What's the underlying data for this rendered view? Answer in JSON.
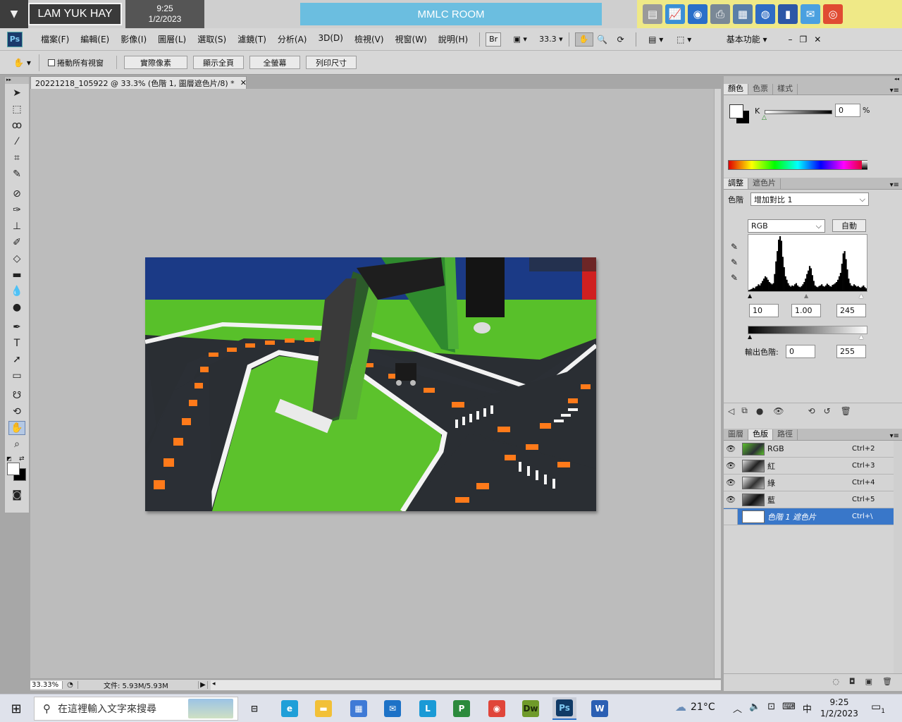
{
  "kiosk": {
    "user_name": "LAM YUK HAY",
    "time": "9:25",
    "date": "1/2/2023",
    "room": "MMLC ROOM",
    "tray_icons": [
      {
        "name": "document-icon",
        "color": "#9a9a9a",
        "glyph": "▤"
      },
      {
        "name": "chart-icon",
        "color": "#3a8fd6",
        "glyph": "📈"
      },
      {
        "name": "disc-icon",
        "color": "#2a6fc9",
        "glyph": "◉"
      },
      {
        "name": "printer-icon",
        "color": "#7a8896",
        "glyph": "⎙"
      },
      {
        "name": "window-icon",
        "color": "#5a7fa8",
        "glyph": "▦"
      },
      {
        "name": "globe-icon",
        "color": "#2f6cc4",
        "glyph": "◍"
      },
      {
        "name": "book-icon",
        "color": "#2d57a6",
        "glyph": "▮"
      },
      {
        "name": "chat-icon",
        "color": "#4aa0e0",
        "glyph": "✉"
      },
      {
        "name": "lifebuoy-icon",
        "color": "#e04b32",
        "glyph": "◎"
      }
    ]
  },
  "menubar": {
    "items": [
      "檔案(F)",
      "編輯(E)",
      "影像(I)",
      "圖層(L)",
      "選取(S)",
      "濾鏡(T)",
      "分析(A)",
      "3D(D)",
      "檢視(V)",
      "視窗(W)",
      "說明(H)"
    ],
    "bridge_label": "Br",
    "zoom_value": "33.3",
    "workspace": "基本功能"
  },
  "options": {
    "scroll_all_label": "捲動所有視窗",
    "buttons": [
      "實際像素",
      "顯示全頁",
      "全螢幕",
      "列印尺寸"
    ]
  },
  "document": {
    "tab_title": "20221218_105922 @ 33.3% (色階 1, 圖層遮色片/8) *",
    "zoom": "33.33%",
    "file_info": "文件: 5.93M/5.93M"
  },
  "color_panel": {
    "tabs": [
      "顏色",
      "色票",
      "樣式"
    ],
    "channel_label": "K",
    "value": "0",
    "unit": "%"
  },
  "adjust_panel": {
    "tabs": [
      "調整",
      "遮色片"
    ],
    "preset_label": "色階",
    "preset_value": "增加對比 1",
    "channel": "RGB",
    "auto_label": "自動",
    "input_black": "10",
    "input_gamma": "1.00",
    "input_white": "245",
    "output_label": "輸出色階:",
    "output_black": "0",
    "output_white": "255",
    "histogram": [
      2,
      3,
      4,
      6,
      5,
      8,
      9,
      12,
      10,
      14,
      18,
      22,
      26,
      24,
      20,
      16,
      14,
      12,
      14,
      30,
      52,
      70,
      90,
      96,
      88,
      60,
      42,
      26,
      20,
      14,
      10,
      8,
      10,
      9,
      12,
      14,
      10,
      8,
      7,
      9,
      12,
      16,
      22,
      30,
      36,
      44,
      40,
      28,
      18,
      10,
      8,
      7,
      9,
      10,
      12,
      9,
      8,
      10,
      13,
      11,
      9,
      8,
      11,
      12,
      14,
      16,
      20,
      26,
      32,
      48,
      66,
      70,
      56,
      38,
      22,
      14,
      10,
      9,
      12,
      10,
      8,
      9,
      7,
      6,
      8,
      10,
      7,
      5
    ]
  },
  "layers_panel": {
    "tabs": [
      "圖層",
      "色版",
      "路徑"
    ],
    "channels": [
      {
        "name": "RGB",
        "shortcut": "Ctrl+2"
      },
      {
        "name": "紅",
        "shortcut": "Ctrl+3"
      },
      {
        "name": "綠",
        "shortcut": "Ctrl+4"
      },
      {
        "name": "藍",
        "shortcut": "Ctrl+5"
      },
      {
        "name": "色階 1 遮色片",
        "shortcut": "Ctrl+\\"
      }
    ]
  },
  "taskbar": {
    "search_placeholder": "在這裡輸入文字來搜尋",
    "temperature": "21°C",
    "ime": "中",
    "time": "9:25",
    "date": "1/2/2023",
    "notification_count": "1",
    "apps": [
      {
        "name": "task-view-icon",
        "label": "⊟",
        "color": "#dfe2eb",
        "fg": "#222"
      },
      {
        "name": "edge-icon",
        "label": "e",
        "color": "#1f9fd8",
        "fg": "#fff"
      },
      {
        "name": "file-explorer-icon",
        "label": "▬",
        "color": "#f2c037",
        "fg": "#fff"
      },
      {
        "name": "store-icon",
        "label": "▦",
        "color": "#3f7ad6",
        "fg": "#fff"
      },
      {
        "name": "mail-icon",
        "label": "✉",
        "color": "#1d72c7",
        "fg": "#fff"
      },
      {
        "name": "l-app-icon",
        "label": "L",
        "color": "#1a9ad6",
        "fg": "#fff"
      },
      {
        "name": "p-app-icon",
        "label": "P",
        "color": "#2c8a3c",
        "fg": "#fff"
      },
      {
        "name": "chrome-icon",
        "label": "◉",
        "color": "#e0453a",
        "fg": "#fff"
      },
      {
        "name": "dreamweaver-icon",
        "label": "Dw",
        "color": "#6f9a2a",
        "fg": "#1d2b0a"
      },
      {
        "name": "photoshop-icon",
        "label": "Ps",
        "color": "#103a66",
        "fg": "#7fc8f0"
      },
      {
        "name": "word-icon",
        "label": "W",
        "color": "#2b5fb3",
        "fg": "#fff"
      }
    ]
  }
}
